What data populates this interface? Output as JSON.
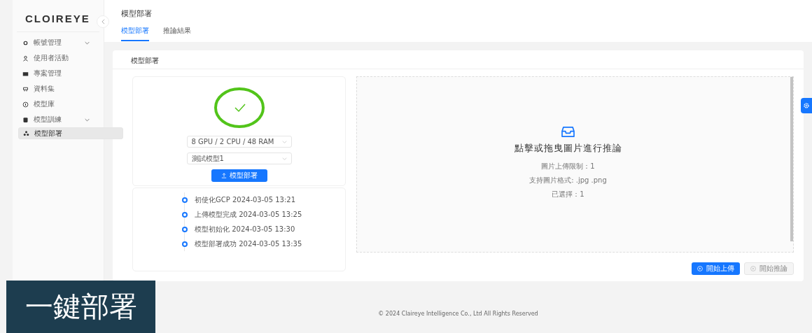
{
  "logo": {
    "text": "CLOIREYE"
  },
  "sidebar": {
    "items": [
      {
        "label": "帳號管理",
        "expandable": true,
        "selected": false
      },
      {
        "label": "使用者活動",
        "expandable": false,
        "selected": false
      },
      {
        "label": "專案管理",
        "expandable": false,
        "selected": false
      },
      {
        "label": "資料集",
        "expandable": false,
        "selected": false
      },
      {
        "label": "模型庫",
        "expandable": false,
        "selected": false
      },
      {
        "label": "模型訓練",
        "expandable": true,
        "selected": false
      },
      {
        "label": "模型部署",
        "expandable": false,
        "selected": true
      }
    ]
  },
  "page_title": "模型部署",
  "tabs": [
    {
      "label": "模型部署",
      "selected": true
    },
    {
      "label": "推論結果",
      "selected": false
    }
  ],
  "card_title": "模型部署",
  "status": {
    "kind": "success"
  },
  "selects": [
    {
      "value": "8 GPU / 2 CPU / 48 RAM"
    },
    {
      "value": "測試模型1"
    }
  ],
  "deploy_button": "模型部署",
  "timeline": [
    {
      "text": "初使化GCP 2024-03-05 13:21"
    },
    {
      "text": "上傳模型完成 2024-03-05 13:25"
    },
    {
      "text": "模型初始化 2024-03-05 13:30"
    },
    {
      "text": "模型部署成功 2024-03-05 13:35"
    }
  ],
  "dropzone": {
    "title": "點擊或拖曳圖片進行推論",
    "lines": [
      "圖片上傳限制：1",
      "支持圖片格式: .jpg .png",
      "已選擇：1"
    ]
  },
  "actions": [
    {
      "label": "開始上傳",
      "disabled": false
    },
    {
      "label": "開始推論",
      "disabled": true
    }
  ],
  "caption": "一鍵部署",
  "footer": "© 2024 Claireye Intelligence Co., Ltd All Rights Reserved"
}
